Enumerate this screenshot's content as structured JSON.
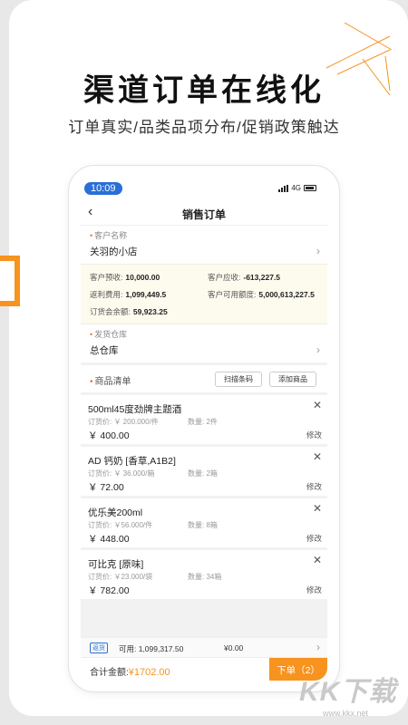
{
  "headline": "渠道订单在线化",
  "subline": "订单真实/品类品项分布/促销政策触达",
  "status": {
    "time": "10:09",
    "network": "4G"
  },
  "nav": {
    "back_icon": "chevron-left-icon",
    "title": "销售订单"
  },
  "customer": {
    "label": "客户名称",
    "value": "关羽的小店"
  },
  "account": {
    "prepay_label": "客户预收:",
    "prepay_value": "10,000.00",
    "receivable_label": "客户应收:",
    "receivable_value": "-613,227.5",
    "rebate_label": "返利费用:",
    "rebate_value": "1,099,449.5",
    "credit_label": "客户可用额度:",
    "credit_value": "5,000,613,227.5",
    "order_balance_label": "订货会余额:",
    "order_balance_value": "59,923.25"
  },
  "warehouse": {
    "label": "发货仓库",
    "value": "总仓库"
  },
  "goods": {
    "label": "商品清单",
    "scan_button": "扫描条码",
    "add_button": "添加商品"
  },
  "items": [
    {
      "name": "500ml45度劲牌主题酒",
      "unit_price": "订货价: ￥ 200.000/件",
      "qty": "数量: 2件",
      "total": "￥ 400.00",
      "edit": "修改"
    },
    {
      "name": "AD 钙奶 [香草,A1B2]",
      "unit_price": "订货价: ￥ 36.000/箱",
      "qty": "数量: 2箱",
      "total": "￥ 72.00",
      "edit": "修改"
    },
    {
      "name": "优乐美200ml",
      "unit_price": "订货价: ￥56.000/件",
      "qty": "数量: 8箱",
      "total": "￥ 448.00",
      "edit": "修改"
    },
    {
      "name": "可比克 [原味]",
      "unit_price": "订货价: ￥23.000/袋",
      "qty": "数量: 34箱",
      "total": "￥ 782.00",
      "edit": "修改"
    }
  ],
  "rebate_bar": {
    "tag": "返货",
    "available": "可用: 1,099,317.50",
    "amount": "¥0.00"
  },
  "footer": {
    "total_label": "合计金额:",
    "total_value": "¥1702.00",
    "submit": "下单（2）"
  },
  "watermark": {
    "text": "KK下载",
    "url": "www.kkx.net"
  },
  "colors": {
    "accent": "#f7931e",
    "blue": "#2a6fd6"
  }
}
